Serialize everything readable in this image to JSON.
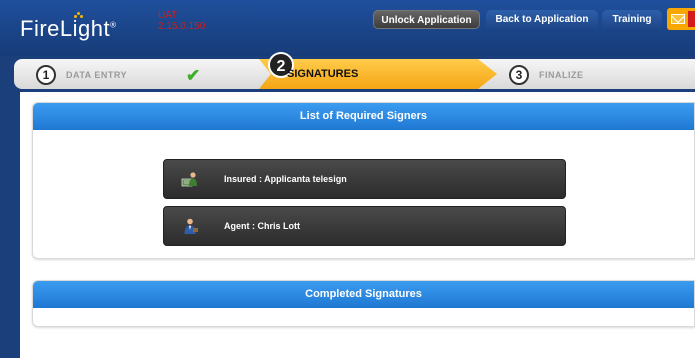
{
  "header": {
    "logo_text": "FireLight",
    "logo_mark": "®",
    "environment": "UAT",
    "version": "2.15.0.150",
    "buttons": {
      "unlock": "Unlock Application",
      "back": "Back to Application",
      "training": "Training"
    },
    "mail_icon": "envelope-icon"
  },
  "steps": [
    {
      "number": "1",
      "label": "DATA ENTRY",
      "status": "complete"
    },
    {
      "number": "2",
      "label": "SIGNATURES",
      "status": "active"
    },
    {
      "number": "3",
      "label": "FINALIZE",
      "status": "pending"
    }
  ],
  "required_signers": {
    "title": "List of Required Signers",
    "signers": [
      {
        "label": "Insured : Applicanta telesign",
        "icon": "insured-person-icon"
      },
      {
        "label": "Agent : Chris Lott",
        "icon": "agent-person-icon"
      }
    ]
  },
  "completed_signatures": {
    "title": "Completed Signatures"
  },
  "colors": {
    "header_bg": "#1f4f9c",
    "active_step": "#f5a515",
    "panel_header": "#1f78d3",
    "env_text": "#c8201e",
    "check": "#3fae2a"
  }
}
